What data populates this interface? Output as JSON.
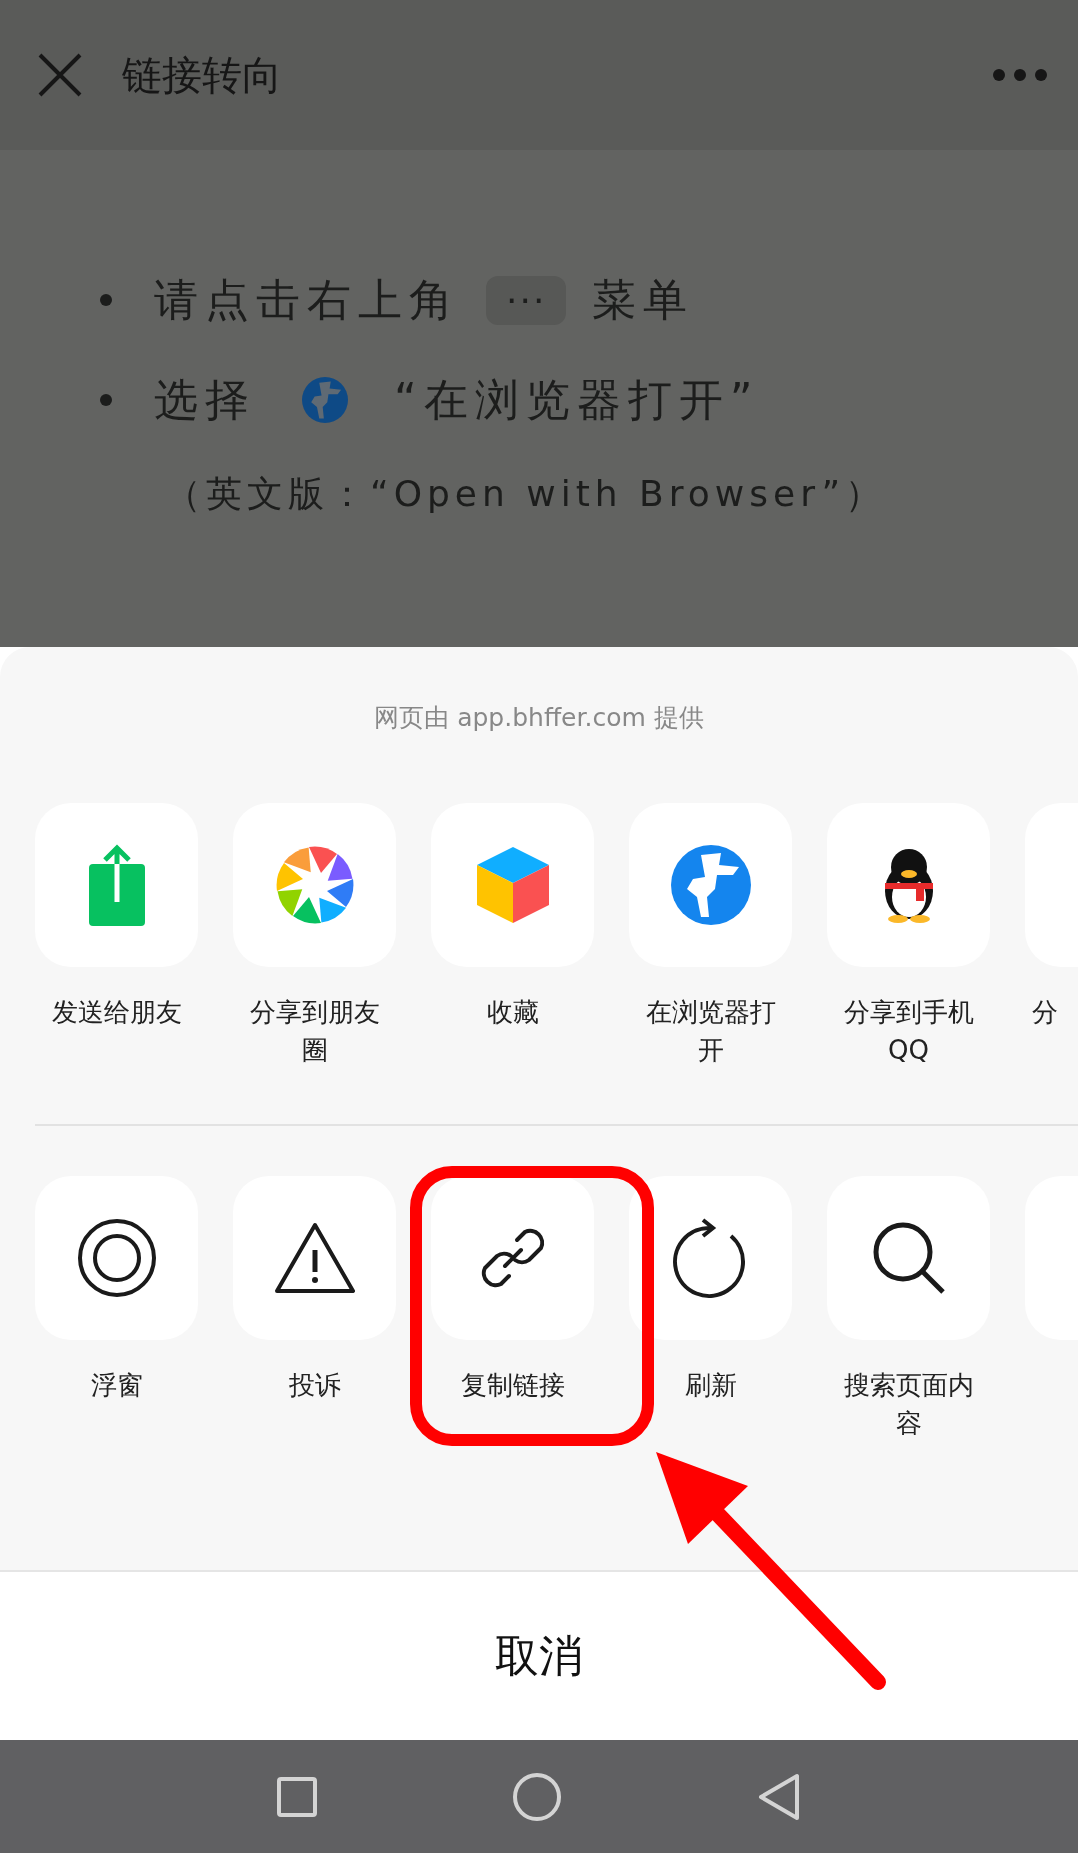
{
  "header": {
    "title": "链接转向"
  },
  "instructions": [
    {
      "kind": "menu",
      "before": "请点击右上角",
      "badge": "···",
      "after": "菜单"
    },
    {
      "kind": "globe",
      "before": "选择",
      "after": "“在浏览器打开”"
    }
  ],
  "note": "（英文版：“Open with Browser”）",
  "sheet": {
    "caption": "网页由 app.bhffer.com 提供",
    "rows": [
      [
        {
          "kind": "send",
          "label": "发送给朋友"
        },
        {
          "kind": "moments",
          "label": "分享到朋友圈"
        },
        {
          "kind": "favorite",
          "label": "收藏"
        },
        {
          "kind": "browser",
          "label": "在浏览器打开"
        },
        {
          "kind": "qq",
          "label": "分享到手机QQ"
        },
        {
          "kind": "cut",
          "label": "分"
        }
      ],
      [
        {
          "kind": "float",
          "label": "浮窗"
        },
        {
          "kind": "report",
          "label": "投诉"
        },
        {
          "kind": "link",
          "label": "复制链接"
        },
        {
          "kind": "refresh",
          "label": "刷新"
        },
        {
          "kind": "search",
          "label": "搜索页面内容"
        },
        {
          "kind": "cut"
        }
      ]
    ],
    "cancel": "取消"
  }
}
